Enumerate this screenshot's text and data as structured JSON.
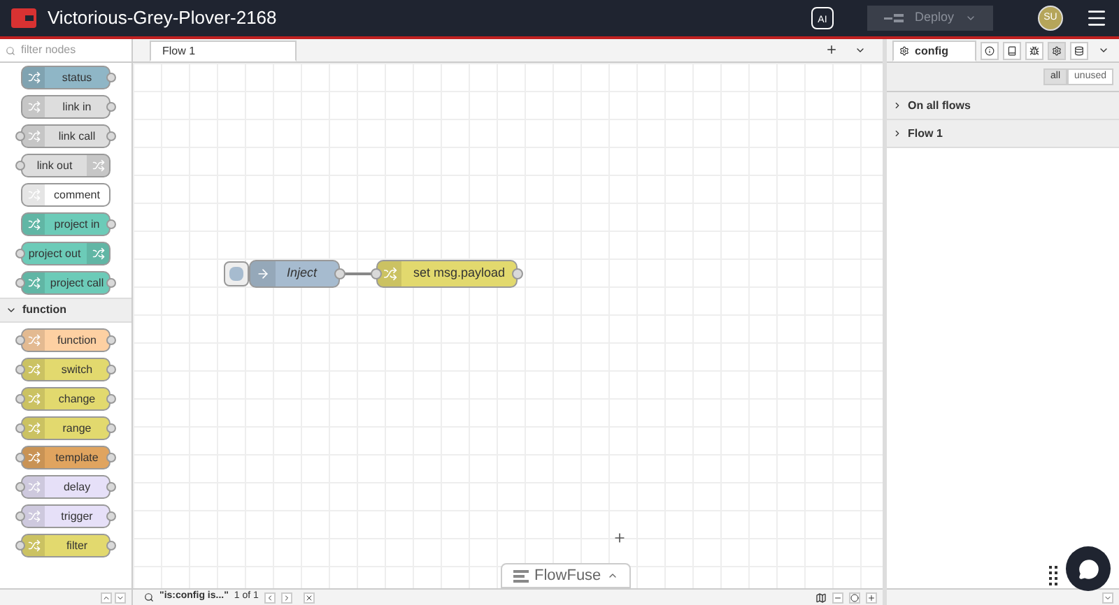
{
  "header": {
    "title": "Victorious-Grey-Plover-2168",
    "deploy": "Deploy",
    "ai_label": "AI",
    "avatar": "SU"
  },
  "palette": {
    "filter_placeholder": "filter nodes",
    "nodes": [
      {
        "label": "status",
        "color": "#8fb6c6",
        "input": false,
        "output": true,
        "icon_right": false
      },
      {
        "label": "link in",
        "color": "#dddddd",
        "input": false,
        "output": true,
        "icon_right": false
      },
      {
        "label": "link call",
        "color": "#dddddd",
        "input": true,
        "output": true,
        "icon_right": false
      },
      {
        "label": "link out",
        "color": "#dddddd",
        "input": true,
        "output": false,
        "icon_right": true
      },
      {
        "label": "comment",
        "color": "#ffffff",
        "input": false,
        "output": false,
        "icon_right": false
      },
      {
        "label": "project in",
        "color": "#6ccbb8",
        "input": false,
        "output": true,
        "icon_right": false
      },
      {
        "label": "project out",
        "color": "#6ccbb8",
        "input": true,
        "output": false,
        "icon_right": true
      },
      {
        "label": "project call",
        "color": "#6ccbb8",
        "input": true,
        "output": true,
        "icon_right": false
      }
    ],
    "category": {
      "label": "function",
      "expanded": true
    },
    "category_nodes": [
      {
        "label": "function",
        "color": "#fdd0a2",
        "input": true,
        "output": true,
        "icon_right": false
      },
      {
        "label": "switch",
        "color": "#e2d96e",
        "input": true,
        "output": true,
        "icon_right": false
      },
      {
        "label": "change",
        "color": "#e2d96e",
        "input": true,
        "output": true,
        "icon_right": false
      },
      {
        "label": "range",
        "color": "#e2d96e",
        "input": true,
        "output": true,
        "icon_right": false
      },
      {
        "label": "template",
        "color": "#e0a45f",
        "input": true,
        "output": true,
        "icon_right": false
      },
      {
        "label": "delay",
        "color": "#e6e0f8",
        "input": true,
        "output": true,
        "icon_right": false
      },
      {
        "label": "trigger",
        "color": "#e6e0f8",
        "input": true,
        "output": true,
        "icon_right": false
      },
      {
        "label": "filter",
        "color": "#e2d96e",
        "input": true,
        "output": true,
        "icon_right": false
      }
    ]
  },
  "workspace": {
    "tabs": [
      {
        "label": "Flow 1",
        "selected": true
      }
    ],
    "nodes": [
      {
        "label": "Inject",
        "color": "#a6bbcf",
        "italic": true,
        "button": true
      },
      {
        "label": "set msg.payload",
        "color": "#e2d96e",
        "italic": false,
        "button": false
      }
    ],
    "search": {
      "query": "\"is:config is...\"",
      "count": "1 of 1"
    },
    "brand": "FlowFuse"
  },
  "sidebar": {
    "tab": "config",
    "filter": [
      {
        "label": "all",
        "selected": true
      },
      {
        "label": "unused",
        "selected": false
      }
    ],
    "sections": [
      {
        "label": "On all flows",
        "expanded": false
      },
      {
        "label": "Flow 1",
        "expanded": false
      }
    ]
  }
}
